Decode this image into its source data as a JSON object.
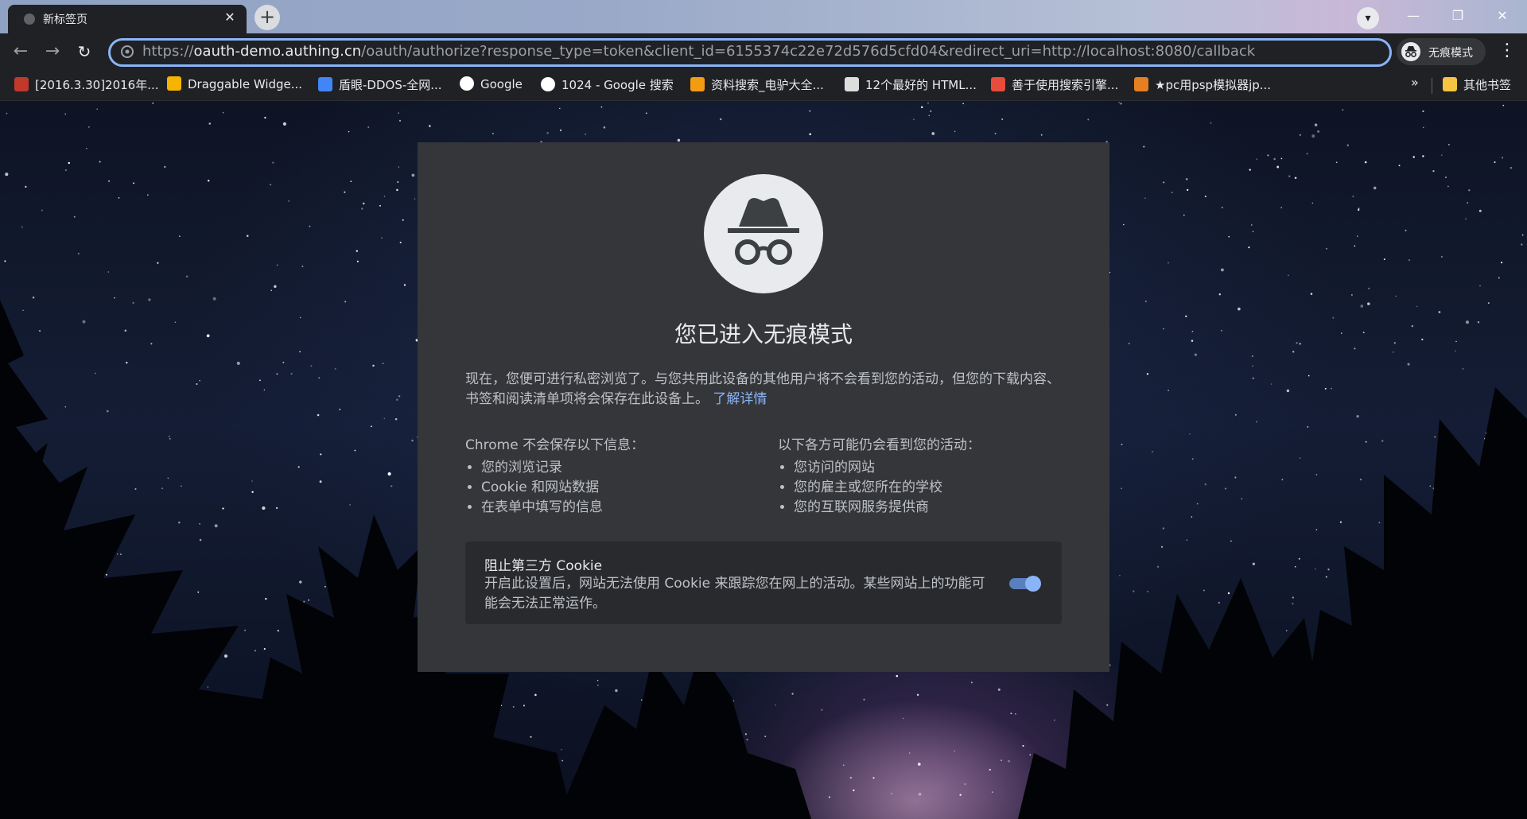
{
  "tab": {
    "title": "新标签页",
    "close": "✕"
  },
  "newtab_label": "+",
  "window_controls": {
    "minimize": "—",
    "maximize": "❐",
    "close": "✕"
  },
  "nav": {
    "back": "←",
    "forward": "→",
    "reload": "↻"
  },
  "omnibox": {
    "scheme": "https://",
    "host": "oauth-demo.authing.cn",
    "rest": "/oauth/authorize?response_type=token&client_id=6155374c22e72d576d5cfd04&redirect_uri=http://localhost:8080/callback"
  },
  "incognito_chip": "无痕模式",
  "menu": "⋮",
  "bookmarks": [
    {
      "label": "[2016.3.30]2016年...",
      "color": "#c0392b"
    },
    {
      "label": "Draggable Widge...",
      "color": "#f4b400"
    },
    {
      "label": "盾眼-DDOS-全网...",
      "color": "#4285f4"
    },
    {
      "label": "Google",
      "color": "#ffffff"
    },
    {
      "label": "1024 - Google 搜索",
      "color": "#ffffff"
    },
    {
      "label": "资料搜索_电驴大全...",
      "color": "#f39c12"
    },
    {
      "label": "12个最好的 HTML...",
      "color": "#dddddd"
    },
    {
      "label": "善于使用搜索引擎...",
      "color": "#e74c3c"
    },
    {
      "label": "★pc用psp模拟器jp...",
      "color": "#e67e22"
    }
  ],
  "bookmarks_more": "»",
  "other_bookmarks": "其他书签",
  "card": {
    "title": "您已进入无痕模式",
    "intro": "现在，您便可进行私密浏览了。与您共用此设备的其他用户将不会看到您的活动，但您的下载内容、书签和阅读清单项将会保存在此设备上。",
    "learn_more": "了解详情",
    "left_header": "Chrome 不会保存以下信息：",
    "left_items": [
      "您的浏览记录",
      "Cookie 和网站数据",
      "在表单中填写的信息"
    ],
    "right_header": "以下各方可能仍会看到您的活动：",
    "right_items": [
      "您访问的网站",
      "您的雇主或您所在的学校",
      "您的互联网服务提供商"
    ],
    "cookie_title": "阻止第三方 Cookie",
    "cookie_desc": "开启此设置后，网站无法使用 Cookie 来跟踪您在网上的活动。某些网站上的功能可能会无法正常运作。",
    "cookie_toggle_on": true
  },
  "colors": {
    "accent": "#8ab4f8",
    "card_bg": "#35363a",
    "chrome_bg": "#202124"
  }
}
